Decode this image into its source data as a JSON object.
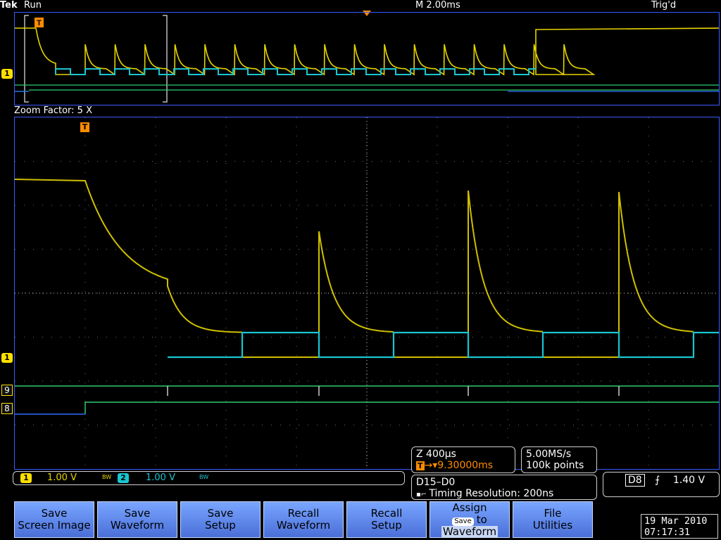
{
  "header": {
    "brand": "Tek",
    "status": "Run",
    "timebase": "M 2.00ms",
    "trigger_state": "Trig'd"
  },
  "overview": {
    "channel_marker": "1"
  },
  "zoom": {
    "label": "Zoom Factor: 5 X",
    "trigger_marker": "T",
    "channel_markers": {
      "ch1": "1",
      "d9": "9",
      "d8": "8"
    }
  },
  "readouts": {
    "zoom_time": "Z 400µs",
    "trigger_pos": "→▾9.30000ms",
    "sample_rate": "5.00MS/s",
    "record_length": "100k points",
    "digital_group": "D15–D0",
    "timing_resolution": "Timing Resolution: 200ns",
    "trigger_source": "D8",
    "trigger_level": "1.40 V"
  },
  "vertical": {
    "ch1_label": "1",
    "ch1_scale": "1.00 V",
    "ch2_label": "2",
    "ch2_scale": "1.00 V",
    "bw_mark": "BW"
  },
  "softkeys": [
    {
      "line1": "Save",
      "line2": "Screen Image"
    },
    {
      "line1": "Save",
      "line2": "Waveform"
    },
    {
      "line1": "Save",
      "line2": "Setup"
    },
    {
      "line1": "Recall",
      "line2": "Waveform"
    },
    {
      "line1": "Recall",
      "line2": "Setup"
    },
    {
      "line1": "Assign",
      "chip": "Save",
      "line2": "to",
      "line3": "Waveform"
    },
    {
      "line1": "File",
      "line2": "Utilities"
    }
  ],
  "datetime": {
    "date": "19 Mar 2010",
    "time": "07:17:31"
  },
  "colors": {
    "ch1": "#e6d400",
    "ch2": "#18c6d0",
    "d9": "#2ecc71",
    "d8": "#2f6bff",
    "trigger": "#ff8c00",
    "grid": "#8a8a8a"
  }
}
